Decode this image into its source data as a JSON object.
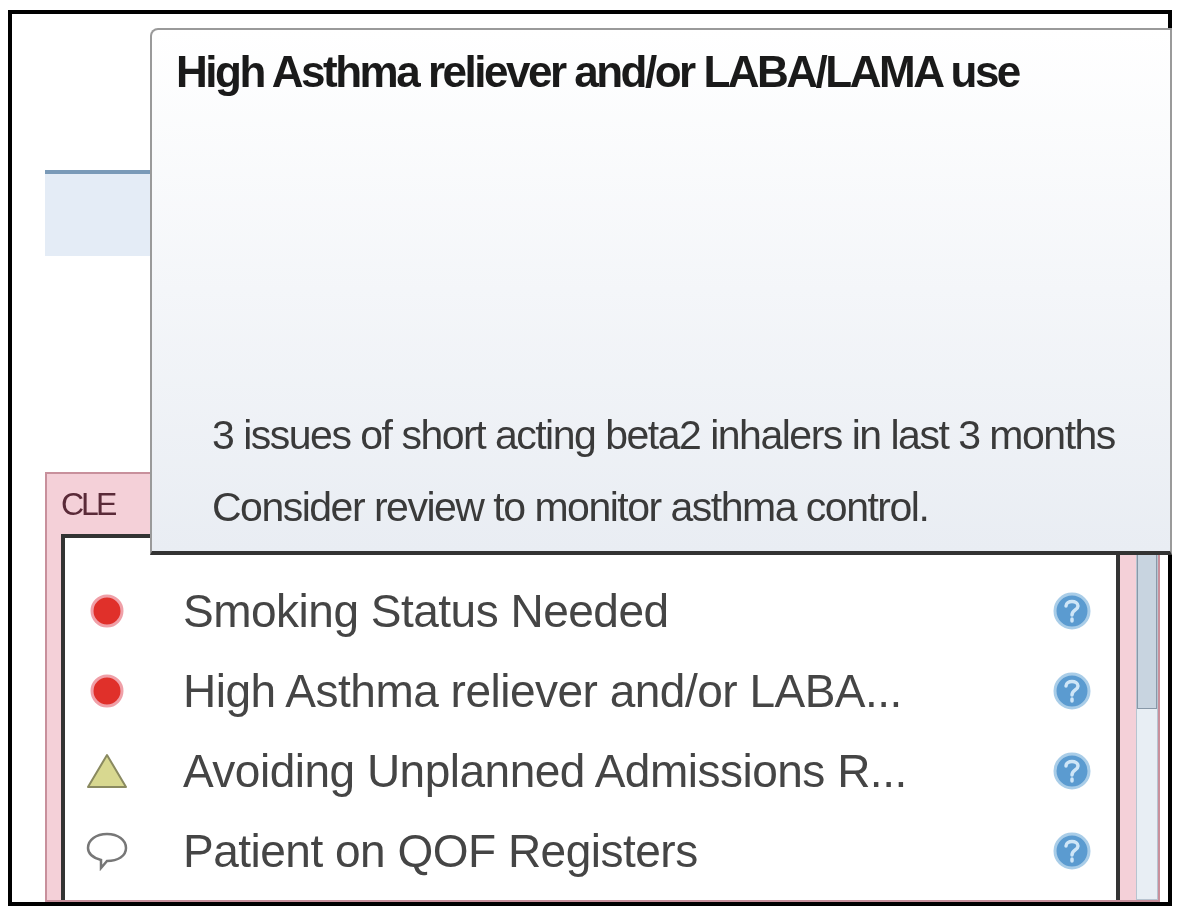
{
  "tooltip": {
    "title": "High Asthma reliever and/or LABA/LAMA use",
    "lines": [
      "3 issues of short acting beta2 inhalers in last 3 months",
      "Consider review to monitor asthma control."
    ]
  },
  "panel": {
    "label": "CLE",
    "items": [
      {
        "kind": "dot",
        "text": "Smoking Status Needed"
      },
      {
        "kind": "dot",
        "text": "High Asthma reliever and/or LABA..."
      },
      {
        "kind": "warning",
        "text": "Avoiding Unplanned Admissions R..."
      },
      {
        "kind": "comment",
        "text": "Patient on QOF Registers"
      }
    ]
  }
}
